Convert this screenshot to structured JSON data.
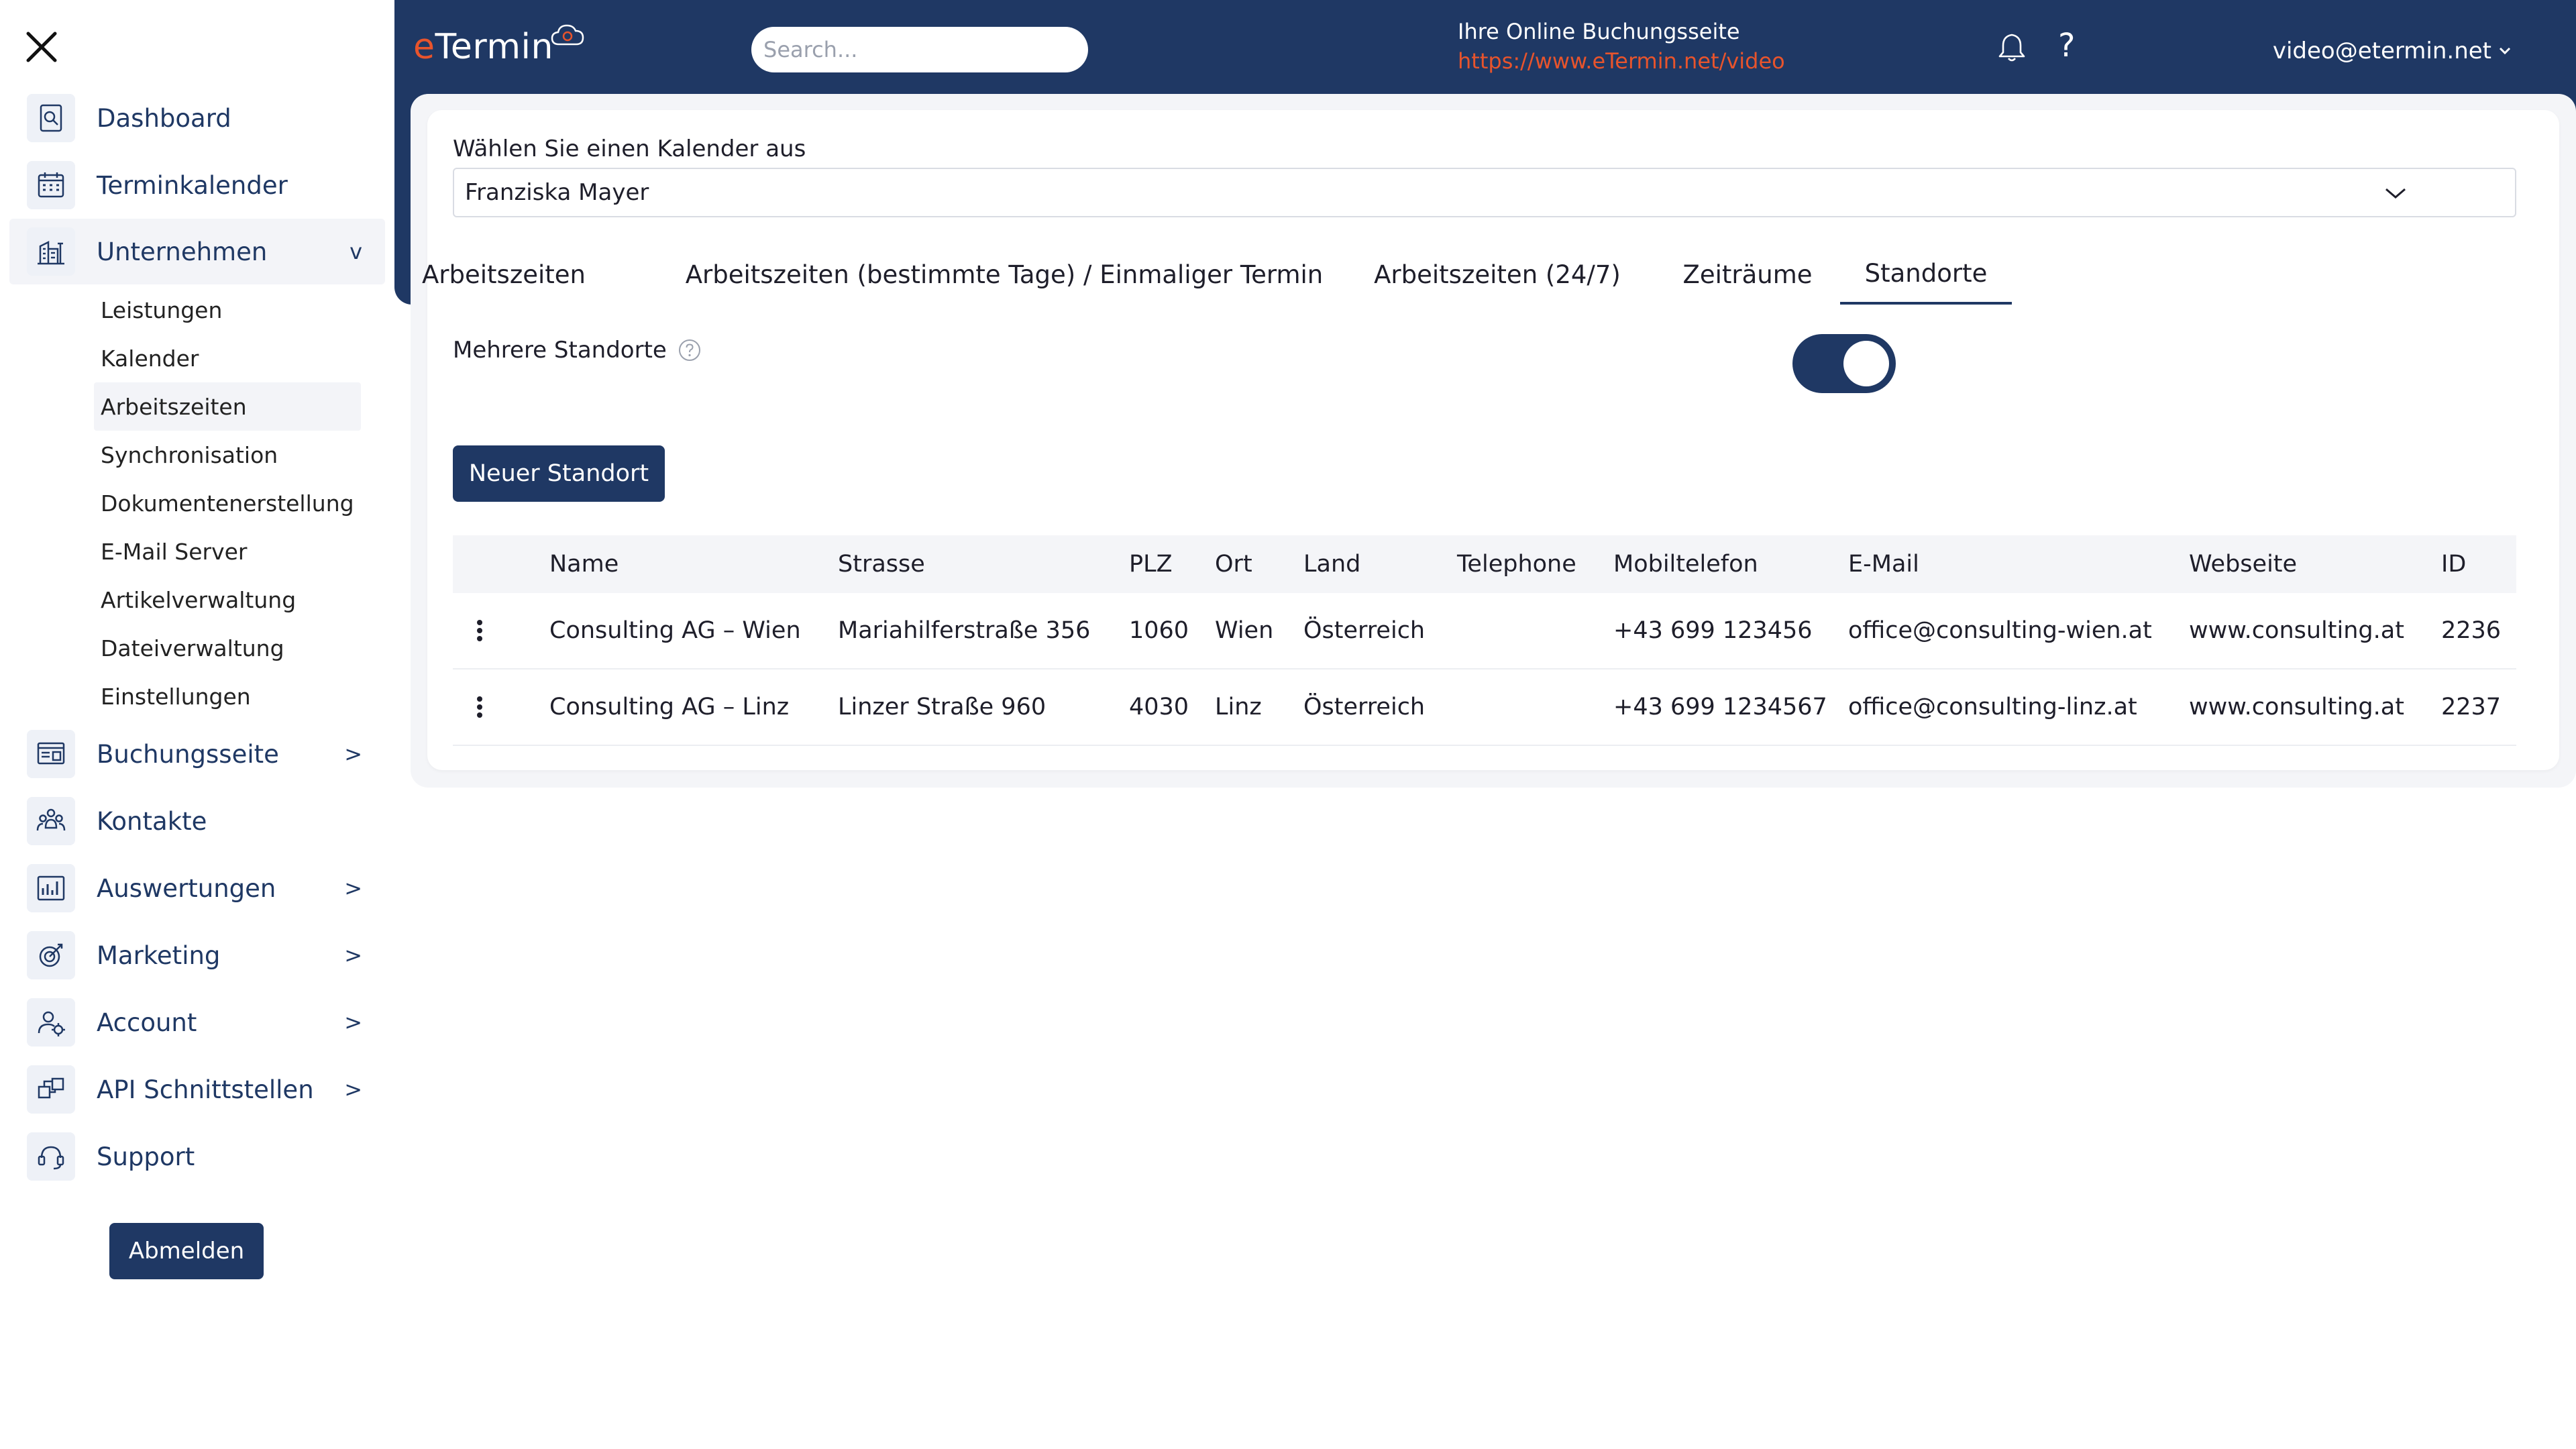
{
  "header": {
    "logo_e": "e",
    "logo_rest": "Termin",
    "search_placeholder": "Search...",
    "booking_title": "Ihre Online Buchungsseite",
    "booking_url": "https://www.eTermin.net/video",
    "help_label": "?",
    "user_email": "video@etermin.net",
    "user_caret": "⌄"
  },
  "sidebar": {
    "items": [
      {
        "label": "Dashboard",
        "icon": "dashboard-icon"
      },
      {
        "label": "Terminkalender",
        "icon": "calendar-icon"
      },
      {
        "label": "Unternehmen",
        "icon": "company-icon",
        "chevron": "v"
      },
      {
        "label": "Buchungsseite",
        "icon": "booking-page-icon",
        "chevron": ">"
      },
      {
        "label": "Kontakte",
        "icon": "contacts-icon"
      },
      {
        "label": "Auswertungen",
        "icon": "reports-icon",
        "chevron": ">"
      },
      {
        "label": "Marketing",
        "icon": "marketing-icon",
        "chevron": ">"
      },
      {
        "label": "Account",
        "icon": "account-icon",
        "chevron": ">"
      },
      {
        "label": "API Schnittstellen",
        "icon": "api-icon",
        "chevron": ">"
      },
      {
        "label": "Support",
        "icon": "support-icon"
      }
    ],
    "sub_items": [
      "Leistungen",
      "Kalender",
      "Arbeitszeiten",
      "Synchronisation",
      "Dokumentenerstellung",
      "E-Mail Server",
      "Artikelverwaltung",
      "Dateiverwaltung",
      "Einstellungen"
    ],
    "logout_label": "Abmelden"
  },
  "main": {
    "calendar_label": "Wählen Sie einen Kalender aus",
    "calendar_value": "Franziska Mayer",
    "tabs": [
      {
        "label": "Arbeitszeiten"
      },
      {
        "label": "Arbeitszeiten (bestimmte Tage) / Einmaliger Termin"
      },
      {
        "label": "Arbeitszeiten (24/7)"
      },
      {
        "label": "Zeiträume"
      },
      {
        "label": "Standorte"
      }
    ],
    "active_tab": "Standorte",
    "multi_location_label": "Mehrere Standorte",
    "multi_location_enabled": true,
    "new_location_label": "Neuer Standort",
    "table": {
      "columns": [
        "Name",
        "Strasse",
        "PLZ",
        "Ort",
        "Land",
        "Telephone",
        "Mobiltelefon",
        "E-Mail",
        "Webseite",
        "ID"
      ],
      "rows": [
        [
          "Consulting AG – Wien",
          "Mariahilferstraße 356",
          "1060",
          "Wien",
          "Österreich",
          "",
          "+43 699 123456",
          "office@consulting-wien.at",
          "www.consulting.at",
          "2236"
        ],
        [
          "Consulting AG – Linz",
          "Linzer Straße 960",
          "4030",
          "Linz",
          "Österreich",
          "",
          "+43 699 1234567",
          "office@consulting-linz.at",
          "www.consulting.at",
          "2237"
        ]
      ]
    }
  },
  "colors": {
    "brand_navy": "#1f3864",
    "accent_orange": "#e8542c",
    "panel_gray": "#f4f5f8"
  }
}
